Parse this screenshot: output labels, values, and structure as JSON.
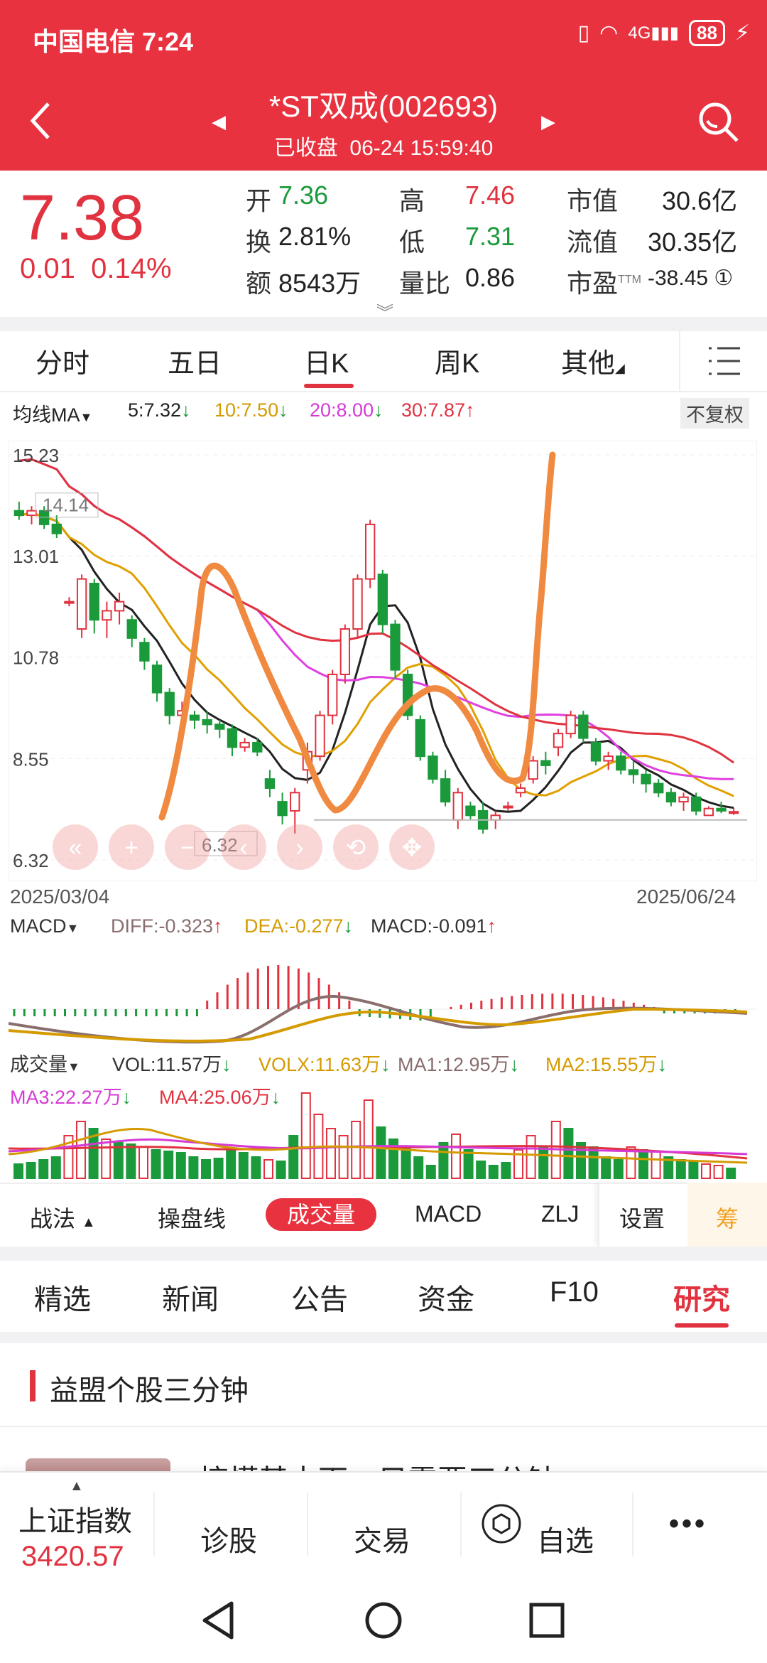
{
  "status_bar": {
    "carrier": "中国电信 7:24",
    "battery": "88",
    "network": "4G"
  },
  "header": {
    "title": "*ST双成(002693)",
    "status": "已收盘",
    "datetime": "06-24 15:59:40",
    "back_icon": "back-icon",
    "search_icon": "search-icon"
  },
  "quote": {
    "price": "7.38",
    "change": "0.01",
    "change_pct": "0.14%",
    "fields": {
      "open_label": "开",
      "open": "7.36",
      "high_label": "高",
      "high": "7.46",
      "mktcap_label": "市值",
      "mktcap": "30.6亿",
      "turnover_label": "换",
      "turnover": "2.81%",
      "low_label": "低",
      "low": "7.31",
      "float_label": "流值",
      "float_cap": "30.35亿",
      "amount_label": "额",
      "amount": "8543万",
      "volratio_label": "量比",
      "volratio": "0.86",
      "pe_label": "市盈",
      "pe_sup": "TTM",
      "pe": "-38.45"
    }
  },
  "period_tabs": [
    "分时",
    "五日",
    "日K",
    "周K",
    "其他"
  ],
  "period_active": "日K",
  "ma_legend": {
    "label": "均线MA",
    "ma5": "5:7.32",
    "ma10": "10:7.50",
    "ma20": "20:8.00",
    "ma30": "30:7.87",
    "adjust": "不复权",
    "colors": {
      "ma5": "#222222",
      "ma10": "#e0a000",
      "ma20": "#e040e0",
      "ma30": "#e0323f"
    }
  },
  "chart_data": {
    "type": "candlestick",
    "y_ticks": [
      "15.23",
      "13.01",
      "10.78",
      "8.55",
      "6.32"
    ],
    "ylim": [
      6.32,
      15.23
    ],
    "max_marker": "14.14",
    "min_marker": "6.32",
    "date_start": "2025/03/04",
    "date_end": "2025/06/24",
    "candles": [
      [
        14.0,
        14.2,
        13.8,
        13.9
      ],
      [
        13.9,
        14.1,
        13.7,
        14.0
      ],
      [
        14.0,
        14.1,
        13.6,
        13.7
      ],
      [
        13.7,
        13.9,
        13.4,
        13.5
      ],
      [
        12.0,
        12.1,
        11.9,
        12.0
      ],
      [
        11.4,
        12.6,
        11.2,
        12.5
      ],
      [
        12.4,
        12.5,
        11.3,
        11.6
      ],
      [
        11.6,
        12.0,
        11.2,
        11.8
      ],
      [
        11.8,
        12.2,
        11.5,
        12.0
      ],
      [
        11.6,
        11.7,
        11.0,
        11.2
      ],
      [
        11.1,
        11.2,
        10.5,
        10.7
      ],
      [
        10.6,
        10.7,
        9.8,
        10.0
      ],
      [
        10.0,
        10.1,
        9.3,
        9.5
      ],
      [
        9.5,
        9.8,
        9.3,
        9.6
      ],
      [
        9.5,
        9.6,
        9.2,
        9.4
      ],
      [
        9.4,
        9.6,
        9.1,
        9.3
      ],
      [
        9.3,
        9.4,
        9.0,
        9.2
      ],
      [
        9.2,
        9.3,
        8.6,
        8.8
      ],
      [
        8.8,
        9.0,
        8.7,
        8.9
      ],
      [
        8.9,
        9.0,
        8.6,
        8.7
      ],
      [
        8.1,
        8.3,
        7.7,
        7.9
      ],
      [
        7.6,
        7.8,
        7.1,
        7.3
      ],
      [
        7.4,
        7.9,
        6.9,
        7.8
      ],
      [
        8.3,
        8.9,
        8.0,
        8.7
      ],
      [
        8.6,
        9.6,
        8.5,
        9.5
      ],
      [
        9.5,
        10.5,
        9.3,
        10.4
      ],
      [
        10.4,
        11.5,
        10.2,
        11.4
      ],
      [
        11.4,
        12.6,
        11.2,
        12.5
      ],
      [
        12.5,
        13.8,
        12.3,
        13.7
      ],
      [
        12.6,
        12.7,
        11.3,
        11.5
      ],
      [
        11.5,
        11.6,
        10.3,
        10.5
      ],
      [
        10.4,
        10.5,
        9.4,
        9.5
      ],
      [
        9.4,
        9.5,
        8.5,
        8.6
      ],
      [
        8.6,
        8.7,
        8.0,
        8.1
      ],
      [
        8.1,
        8.3,
        7.5,
        7.6
      ],
      [
        7.2,
        7.9,
        7.0,
        7.8
      ],
      [
        7.5,
        7.6,
        7.2,
        7.3
      ],
      [
        7.4,
        7.6,
        6.9,
        7.0
      ],
      [
        7.2,
        7.4,
        7.0,
        7.3
      ],
      [
        7.5,
        7.6,
        7.4,
        7.5
      ],
      [
        7.8,
        8.0,
        7.7,
        7.9
      ],
      [
        8.1,
        8.6,
        8.0,
        8.5
      ],
      [
        8.5,
        8.7,
        8.2,
        8.4
      ],
      [
        8.8,
        9.2,
        8.6,
        9.1
      ],
      [
        9.1,
        9.6,
        9.0,
        9.5
      ],
      [
        9.5,
        9.6,
        8.9,
        9.0
      ],
      [
        8.9,
        9.0,
        8.4,
        8.5
      ],
      [
        8.5,
        8.7,
        8.3,
        8.6
      ],
      [
        8.6,
        8.7,
        8.2,
        8.3
      ],
      [
        8.3,
        8.5,
        8.0,
        8.2
      ],
      [
        8.2,
        8.3,
        7.8,
        8.0
      ],
      [
        8.0,
        8.1,
        7.7,
        7.8
      ],
      [
        7.8,
        7.9,
        7.5,
        7.6
      ],
      [
        7.6,
        7.8,
        7.4,
        7.7
      ],
      [
        7.7,
        7.8,
        7.3,
        7.4
      ],
      [
        7.3,
        7.5,
        7.3,
        7.45
      ],
      [
        7.45,
        7.6,
        7.35,
        7.4
      ],
      [
        7.36,
        7.46,
        7.31,
        7.38
      ]
    ]
  },
  "nav_controls": [
    "double-left-icon",
    "zoom-in-icon",
    "zoom-out-icon",
    "left-icon",
    "right-icon",
    "rotate-icon",
    "move-icon"
  ],
  "macd": {
    "label": "MACD",
    "diff": "DIFF:-0.323",
    "dea": "DEA:-0.277",
    "macd": "MACD:-0.091"
  },
  "volume": {
    "label": "成交量",
    "vol": "VOL:11.57万",
    "volx": "VOLX:11.63万",
    "ma1": "MA1:12.95万",
    "ma2": "MA2:15.55万",
    "ma3": "MA3:22.27万",
    "ma4": "MA4:25.06万"
  },
  "indicator_tabs": {
    "zhanfa": "战法",
    "caopan": "操盘线",
    "vol": "成交量",
    "macd": "MACD",
    "zlj": "ZLJ",
    "settings": "设置",
    "chou": "筹"
  },
  "news_tabs": [
    "精选",
    "新闻",
    "公告",
    "资金",
    "F10",
    "研究"
  ],
  "news_active": "研究",
  "section": {
    "title": "益盟个股三分钟"
  },
  "article": {
    "title": "搞懂基本面，只需要三分钟"
  },
  "bottom_nav": {
    "index_name": "上证指数",
    "index_value": "3420.57",
    "diagnose": "诊股",
    "trade": "交易",
    "watchlist": "自选"
  }
}
